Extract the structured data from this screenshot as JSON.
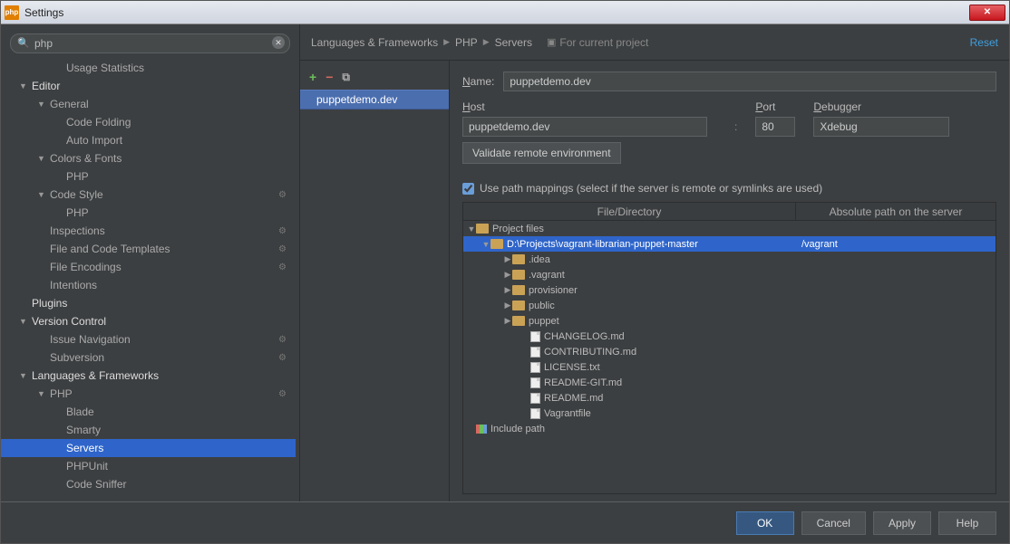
{
  "window": {
    "title": "Settings"
  },
  "search": {
    "value": "php"
  },
  "sidebar": [
    {
      "label": "Usage Statistics",
      "depth": 2,
      "arrow": ""
    },
    {
      "label": "Editor",
      "depth": 0,
      "arrow": "▼",
      "heading": true
    },
    {
      "label": "General",
      "depth": 1,
      "arrow": "▼"
    },
    {
      "label": "Code Folding",
      "depth": 2,
      "arrow": ""
    },
    {
      "label": "Auto Import",
      "depth": 2,
      "arrow": ""
    },
    {
      "label": "Colors & Fonts",
      "depth": 1,
      "arrow": "▼"
    },
    {
      "label": "PHP",
      "depth": 2,
      "arrow": ""
    },
    {
      "label": "Code Style",
      "depth": 1,
      "arrow": "▼",
      "gear": true
    },
    {
      "label": "PHP",
      "depth": 2,
      "arrow": ""
    },
    {
      "label": "Inspections",
      "depth": 1,
      "arrow": "",
      "gear": true
    },
    {
      "label": "File and Code Templates",
      "depth": 1,
      "arrow": "",
      "gear": true
    },
    {
      "label": "File Encodings",
      "depth": 1,
      "arrow": "",
      "gear": true
    },
    {
      "label": "Intentions",
      "depth": 1,
      "arrow": ""
    },
    {
      "label": "Plugins",
      "depth": 0,
      "arrow": "",
      "heading": true
    },
    {
      "label": "Version Control",
      "depth": 0,
      "arrow": "▼",
      "heading": true
    },
    {
      "label": "Issue Navigation",
      "depth": 1,
      "arrow": "",
      "gear": true
    },
    {
      "label": "Subversion",
      "depth": 1,
      "arrow": "",
      "gear": true
    },
    {
      "label": "Languages & Frameworks",
      "depth": 0,
      "arrow": "▼",
      "heading": true
    },
    {
      "label": "PHP",
      "depth": 1,
      "arrow": "▼",
      "gear": true
    },
    {
      "label": "Blade",
      "depth": 2,
      "arrow": ""
    },
    {
      "label": "Smarty",
      "depth": 2,
      "arrow": ""
    },
    {
      "label": "Servers",
      "depth": 2,
      "arrow": "",
      "selected": true
    },
    {
      "label": "PHPUnit",
      "depth": 2,
      "arrow": ""
    },
    {
      "label": "Code Sniffer",
      "depth": 2,
      "arrow": ""
    }
  ],
  "breadcrumb": {
    "parts": [
      "Languages & Frameworks",
      "PHP",
      "Servers"
    ],
    "projectNote": "For current project",
    "reset": "Reset"
  },
  "serverList": {
    "items": [
      "puppetdemo.dev"
    ]
  },
  "form": {
    "nameLabel": "Name:",
    "name": "puppetdemo.dev",
    "hostLabel": "Host",
    "host": "puppetdemo.dev",
    "portLabel": "Port",
    "port": "80",
    "debuggerLabel": "Debugger",
    "debugger": "Xdebug",
    "validateBtn": "Validate remote environment",
    "pathMappingsLabel": "Use path mappings (select if the server is remote or symlinks are used)",
    "cols": {
      "left": "File/Directory",
      "right": "Absolute path on the server"
    },
    "mappings": [
      {
        "depth": 0,
        "arrow": "▼",
        "icon": "fld",
        "label": "Project files",
        "right": ""
      },
      {
        "depth": 1,
        "arrow": "▼",
        "icon": "fld",
        "label": "D:\\Projects\\vagrant-librarian-puppet-master",
        "right": "/vagrant",
        "selected": true
      },
      {
        "depth": 2,
        "arrow": "▶",
        "icon": "fld",
        "label": ".idea",
        "right": ""
      },
      {
        "depth": 2,
        "arrow": "▶",
        "icon": "fld",
        "label": ".vagrant",
        "right": ""
      },
      {
        "depth": 2,
        "arrow": "▶",
        "icon": "fld",
        "label": "provisioner",
        "right": ""
      },
      {
        "depth": 2,
        "arrow": "▶",
        "icon": "fld",
        "label": "public",
        "right": ""
      },
      {
        "depth": 2,
        "arrow": "▶",
        "icon": "fld",
        "label": "puppet",
        "right": ""
      },
      {
        "depth": 3,
        "arrow": "",
        "icon": "fil",
        "label": "CHANGELOG.md",
        "right": ""
      },
      {
        "depth": 3,
        "arrow": "",
        "icon": "fil",
        "label": "CONTRIBUTING.md",
        "right": ""
      },
      {
        "depth": 3,
        "arrow": "",
        "icon": "fil",
        "label": "LICENSE.txt",
        "right": ""
      },
      {
        "depth": 3,
        "arrow": "",
        "icon": "fil",
        "label": "README-GIT.md",
        "right": ""
      },
      {
        "depth": 3,
        "arrow": "",
        "icon": "fil",
        "label": "README.md",
        "right": ""
      },
      {
        "depth": 3,
        "arrow": "",
        "icon": "fil",
        "label": "Vagrantfile",
        "right": ""
      },
      {
        "depth": 0,
        "arrow": "",
        "icon": "inc",
        "label": "Include path",
        "right": ""
      }
    ]
  },
  "buttons": {
    "ok": "OK",
    "cancel": "Cancel",
    "apply": "Apply",
    "help": "Help"
  }
}
